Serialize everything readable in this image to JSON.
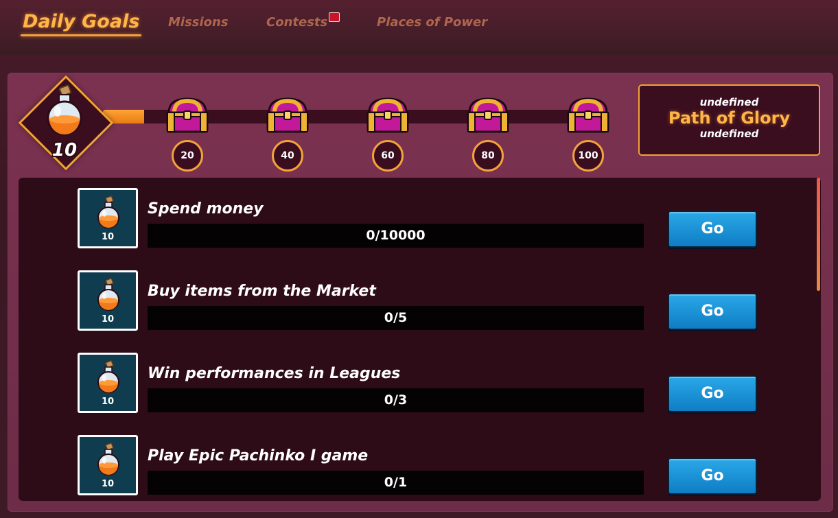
{
  "nav": {
    "tabs": [
      {
        "label": "Daily Goals",
        "active": true
      },
      {
        "label": "Missions",
        "active": false
      },
      {
        "label": "Contests",
        "active": false,
        "has_notification": true
      },
      {
        "label": "Places of Power",
        "active": false
      }
    ]
  },
  "progress": {
    "current_points": "10",
    "current_value": 10,
    "max_value": 100,
    "milestones": [
      "20",
      "40",
      "60",
      "80",
      "100"
    ],
    "reward_icon": "chest-icon"
  },
  "path_of_glory": {
    "line1": "undefined",
    "title": "Path of Glory",
    "line2": "undefined"
  },
  "quests": [
    {
      "title": "Spend money",
      "progress": "0/10000",
      "reward": "10",
      "button": "Go",
      "icon": "potion-icon"
    },
    {
      "title": "Buy items from the Market",
      "progress": "0/5",
      "reward": "10",
      "button": "Go",
      "icon": "potion-icon"
    },
    {
      "title": "Win performances in Leagues",
      "progress": "0/3",
      "reward": "10",
      "button": "Go",
      "icon": "potion-icon"
    },
    {
      "title": "Play Epic Pachinko I game",
      "progress": "0/1",
      "reward": "10",
      "button": "Go",
      "icon": "potion-icon"
    }
  ],
  "colors": {
    "accent": "#f4a23c",
    "button": "#1a8fd2",
    "panel": "#7b3250",
    "list_bg": "#2e0c17"
  }
}
